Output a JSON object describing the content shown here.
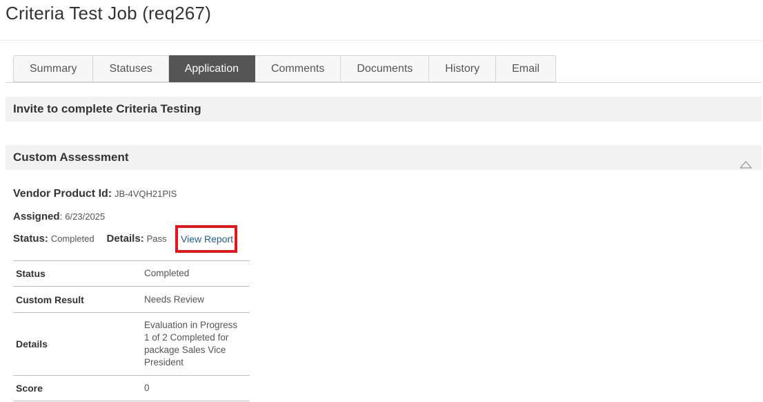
{
  "page": {
    "title": "Criteria Test Job (req267)"
  },
  "tabs": [
    {
      "label": "Summary"
    },
    {
      "label": "Statuses"
    },
    {
      "label": "Application",
      "active": true
    },
    {
      "label": "Comments"
    },
    {
      "label": "Documents"
    },
    {
      "label": "History"
    },
    {
      "label": "Email"
    }
  ],
  "sections": {
    "invite": {
      "title": "Invite to complete Criteria Testing"
    },
    "assessment": {
      "title": "Custom Assessment",
      "collapse_icon": "chevron-up-icon"
    }
  },
  "assessment": {
    "vendor_label": "Vendor Product Id:",
    "vendor_value": "JB-4VQH21PIS",
    "assigned_label": "Assigned",
    "assigned_colon": ":",
    "assigned_value": "6/23/2025",
    "status_label": "Status:",
    "status_value": "Completed",
    "details_label": "Details:",
    "details_value": "Pass",
    "view_report": "View Report"
  },
  "results_table": [
    {
      "label": "Status",
      "value": "Completed"
    },
    {
      "label": "Custom Result",
      "value": "Needs Review"
    },
    {
      "label": "Details",
      "value": "Evaluation in Progress 1 of 2 Completed for package Sales Vice President"
    },
    {
      "label": "Score",
      "value": "0"
    }
  ],
  "colors": {
    "active_tab": "#555555",
    "link": "#1f5e93",
    "highlight": "#e8141c",
    "section_bar": "#f2f2f2"
  }
}
